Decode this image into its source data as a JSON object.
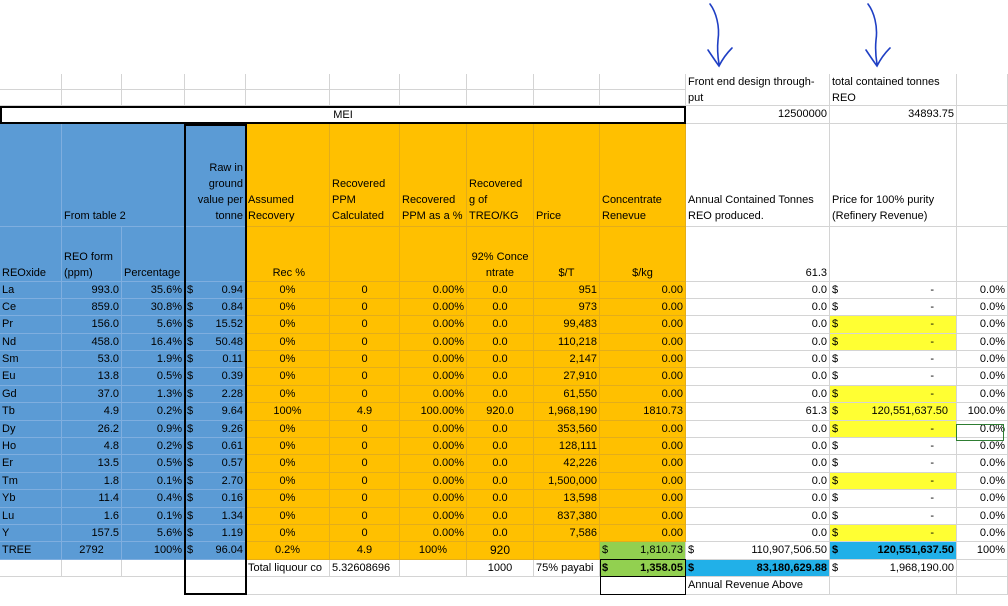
{
  "header": {
    "front_end_label": "Front end design through-put",
    "front_end_value": "12500000",
    "contained_label": "total contained tonnes REO",
    "contained_value": "34893.75",
    "mei_label": "MEI"
  },
  "col_headers": {
    "from_table": "From table 2",
    "raw_in_ground": "Raw in ground value per tonne",
    "assumed_recovery": "Assumed Recovery",
    "recovered_ppm_calc": "Recovered PPM Calculated",
    "recovered_ppm_pct": "Recovered PPM as a %",
    "recovered_g_kg": "Recovered g of TREO/KG",
    "price": "Price",
    "concentrate_revenue": "Concentrate Renevue",
    "annual_contained": "Annual Contained Tonnes REO produced.",
    "price_purity": "Price for 100% purity (Refinery Revenue)"
  },
  "sub_headers": {
    "reoxide": "REOxide",
    "reo_form": "REO form (ppm)",
    "percentage": "Percentage",
    "rec_pct": "Rec %",
    "concentrate_92": "92% Concentrate",
    "per_t": "$/T",
    "per_kg": "$/kg",
    "annual_total": "61.3"
  },
  "rows": [
    {
      "el": "La",
      "reo": "993.0",
      "pct": "35.6%",
      "raw": "0.94",
      "rec": "0%",
      "ppm": "0",
      "ppmpct": "0.00%",
      "gkg": "0.0",
      "price": "951",
      "rev": "0.00",
      "annual": "0.0",
      "refinery": "-",
      "share": "0.0%"
    },
    {
      "el": "Ce",
      "reo": "859.0",
      "pct": "30.8%",
      "raw": "0.84",
      "rec": "0%",
      "ppm": "0",
      "ppmpct": "0.00%",
      "gkg": "0.0",
      "price": "973",
      "rev": "0.00",
      "annual": "0.0",
      "refinery": "-",
      "share": "0.0%"
    },
    {
      "el": "Pr",
      "reo": "156.0",
      "pct": "5.6%",
      "raw": "15.52",
      "rec": "0%",
      "ppm": "0",
      "ppmpct": "0.00%",
      "gkg": "0.0",
      "price": "99,483",
      "rev": "0.00",
      "annual": "0.0",
      "refinery": "-",
      "share": "0.0%"
    },
    {
      "el": "Nd",
      "reo": "458.0",
      "pct": "16.4%",
      "raw": "50.48",
      "rec": "0%",
      "ppm": "0",
      "ppmpct": "0.00%",
      "gkg": "0.0",
      "price": "110,218",
      "rev": "0.00",
      "annual": "0.0",
      "refinery": "-",
      "share": "0.0%"
    },
    {
      "el": "Sm",
      "reo": "53.0",
      "pct": "1.9%",
      "raw": "0.11",
      "rec": "0%",
      "ppm": "0",
      "ppmpct": "0.00%",
      "gkg": "0.0",
      "price": "2,147",
      "rev": "0.00",
      "annual": "0.0",
      "refinery": "-",
      "share": "0.0%"
    },
    {
      "el": "Eu",
      "reo": "13.8",
      "pct": "0.5%",
      "raw": "0.39",
      "rec": "0%",
      "ppm": "0",
      "ppmpct": "0.00%",
      "gkg": "0.0",
      "price": "27,910",
      "rev": "0.00",
      "annual": "0.0",
      "refinery": "-",
      "share": "0.0%"
    },
    {
      "el": "Gd",
      "reo": "37.0",
      "pct": "1.3%",
      "raw": "2.28",
      "rec": "0%",
      "ppm": "0",
      "ppmpct": "0.00%",
      "gkg": "0.0",
      "price": "61,550",
      "rev": "0.00",
      "annual": "0.0",
      "refinery": "-",
      "share": "0.0%"
    },
    {
      "el": "Tb",
      "reo": "4.9",
      "pct": "0.2%",
      "raw": "9.64",
      "rec": "100%",
      "ppm": "4.9",
      "ppmpct": "100.00%",
      "gkg": "920.0",
      "price": "1,968,190",
      "rev": "1810.73",
      "annual": "61.3",
      "refinery": "120,551,637.50",
      "share": "100.0%"
    },
    {
      "el": "Dy",
      "reo": "26.2",
      "pct": "0.9%",
      "raw": "9.26",
      "rec": "0%",
      "ppm": "0",
      "ppmpct": "0.00%",
      "gkg": "0.0",
      "price": "353,560",
      "rev": "0.00",
      "annual": "0.0",
      "refinery": "-",
      "share": "0.0%"
    },
    {
      "el": "Ho",
      "reo": "4.8",
      "pct": "0.2%",
      "raw": "0.61",
      "rec": "0%",
      "ppm": "0",
      "ppmpct": "0.00%",
      "gkg": "0.0",
      "price": "128,111",
      "rev": "0.00",
      "annual": "0.0",
      "refinery": "-",
      "share": "0.0%"
    },
    {
      "el": "Er",
      "reo": "13.5",
      "pct": "0.5%",
      "raw": "0.57",
      "rec": "0%",
      "ppm": "0",
      "ppmpct": "0.00%",
      "gkg": "0.0",
      "price": "42,226",
      "rev": "0.00",
      "annual": "0.0",
      "refinery": "-",
      "share": "0.0%"
    },
    {
      "el": "Tm",
      "reo": "1.8",
      "pct": "0.1%",
      "raw": "2.70",
      "rec": "0%",
      "ppm": "0",
      "ppmpct": "0.00%",
      "gkg": "0.0",
      "price": "1,500,000",
      "rev": "0.00",
      "annual": "0.0",
      "refinery": "-",
      "share": "0.0%"
    },
    {
      "el": "Yb",
      "reo": "11.4",
      "pct": "0.4%",
      "raw": "0.16",
      "rec": "0%",
      "ppm": "0",
      "ppmpct": "0.00%",
      "gkg": "0.0",
      "price": "13,598",
      "rev": "0.00",
      "annual": "0.0",
      "refinery": "-",
      "share": "0.0%"
    },
    {
      "el": "Lu",
      "reo": "1.6",
      "pct": "0.1%",
      "raw": "1.34",
      "rec": "0%",
      "ppm": "0",
      "ppmpct": "0.00%",
      "gkg": "0.0",
      "price": "837,380",
      "rev": "0.00",
      "annual": "0.0",
      "refinery": "-",
      "share": "0.0%"
    },
    {
      "el": "Y",
      "reo": "157.5",
      "pct": "5.6%",
      "raw": "1.19",
      "rec": "0%",
      "ppm": "0",
      "ppmpct": "0.00%",
      "gkg": "0.0",
      "price": "7,586",
      "rev": "0.00",
      "annual": "0.0",
      "refinery": "-",
      "share": "0.0%"
    }
  ],
  "yellow_rows": [
    2,
    3,
    6,
    7,
    8,
    11,
    14
  ],
  "tree": {
    "label": "TREE",
    "reo": "2792",
    "pct": "100%",
    "raw": "96.04",
    "rec": "0.2%",
    "ppm": "4.9",
    "ppmpct": "100%",
    "gkg": "920",
    "rev": "1,810.73",
    "annual": "110,907,506.50",
    "refinery": "120,551,637.50",
    "share": "100%"
  },
  "footer": {
    "total_liquor_label": "Total liquour co",
    "total_liquor_value": "5.32608696",
    "g_value": "1000",
    "payable_label": "75% payabi",
    "payable_value": "1,358.05",
    "annual_revenue_value": "83,180,629.88",
    "price_value": "1,968,190.00",
    "annual_revenue_label": "Annual Revenue Above"
  },
  "currency_symbol": "$"
}
